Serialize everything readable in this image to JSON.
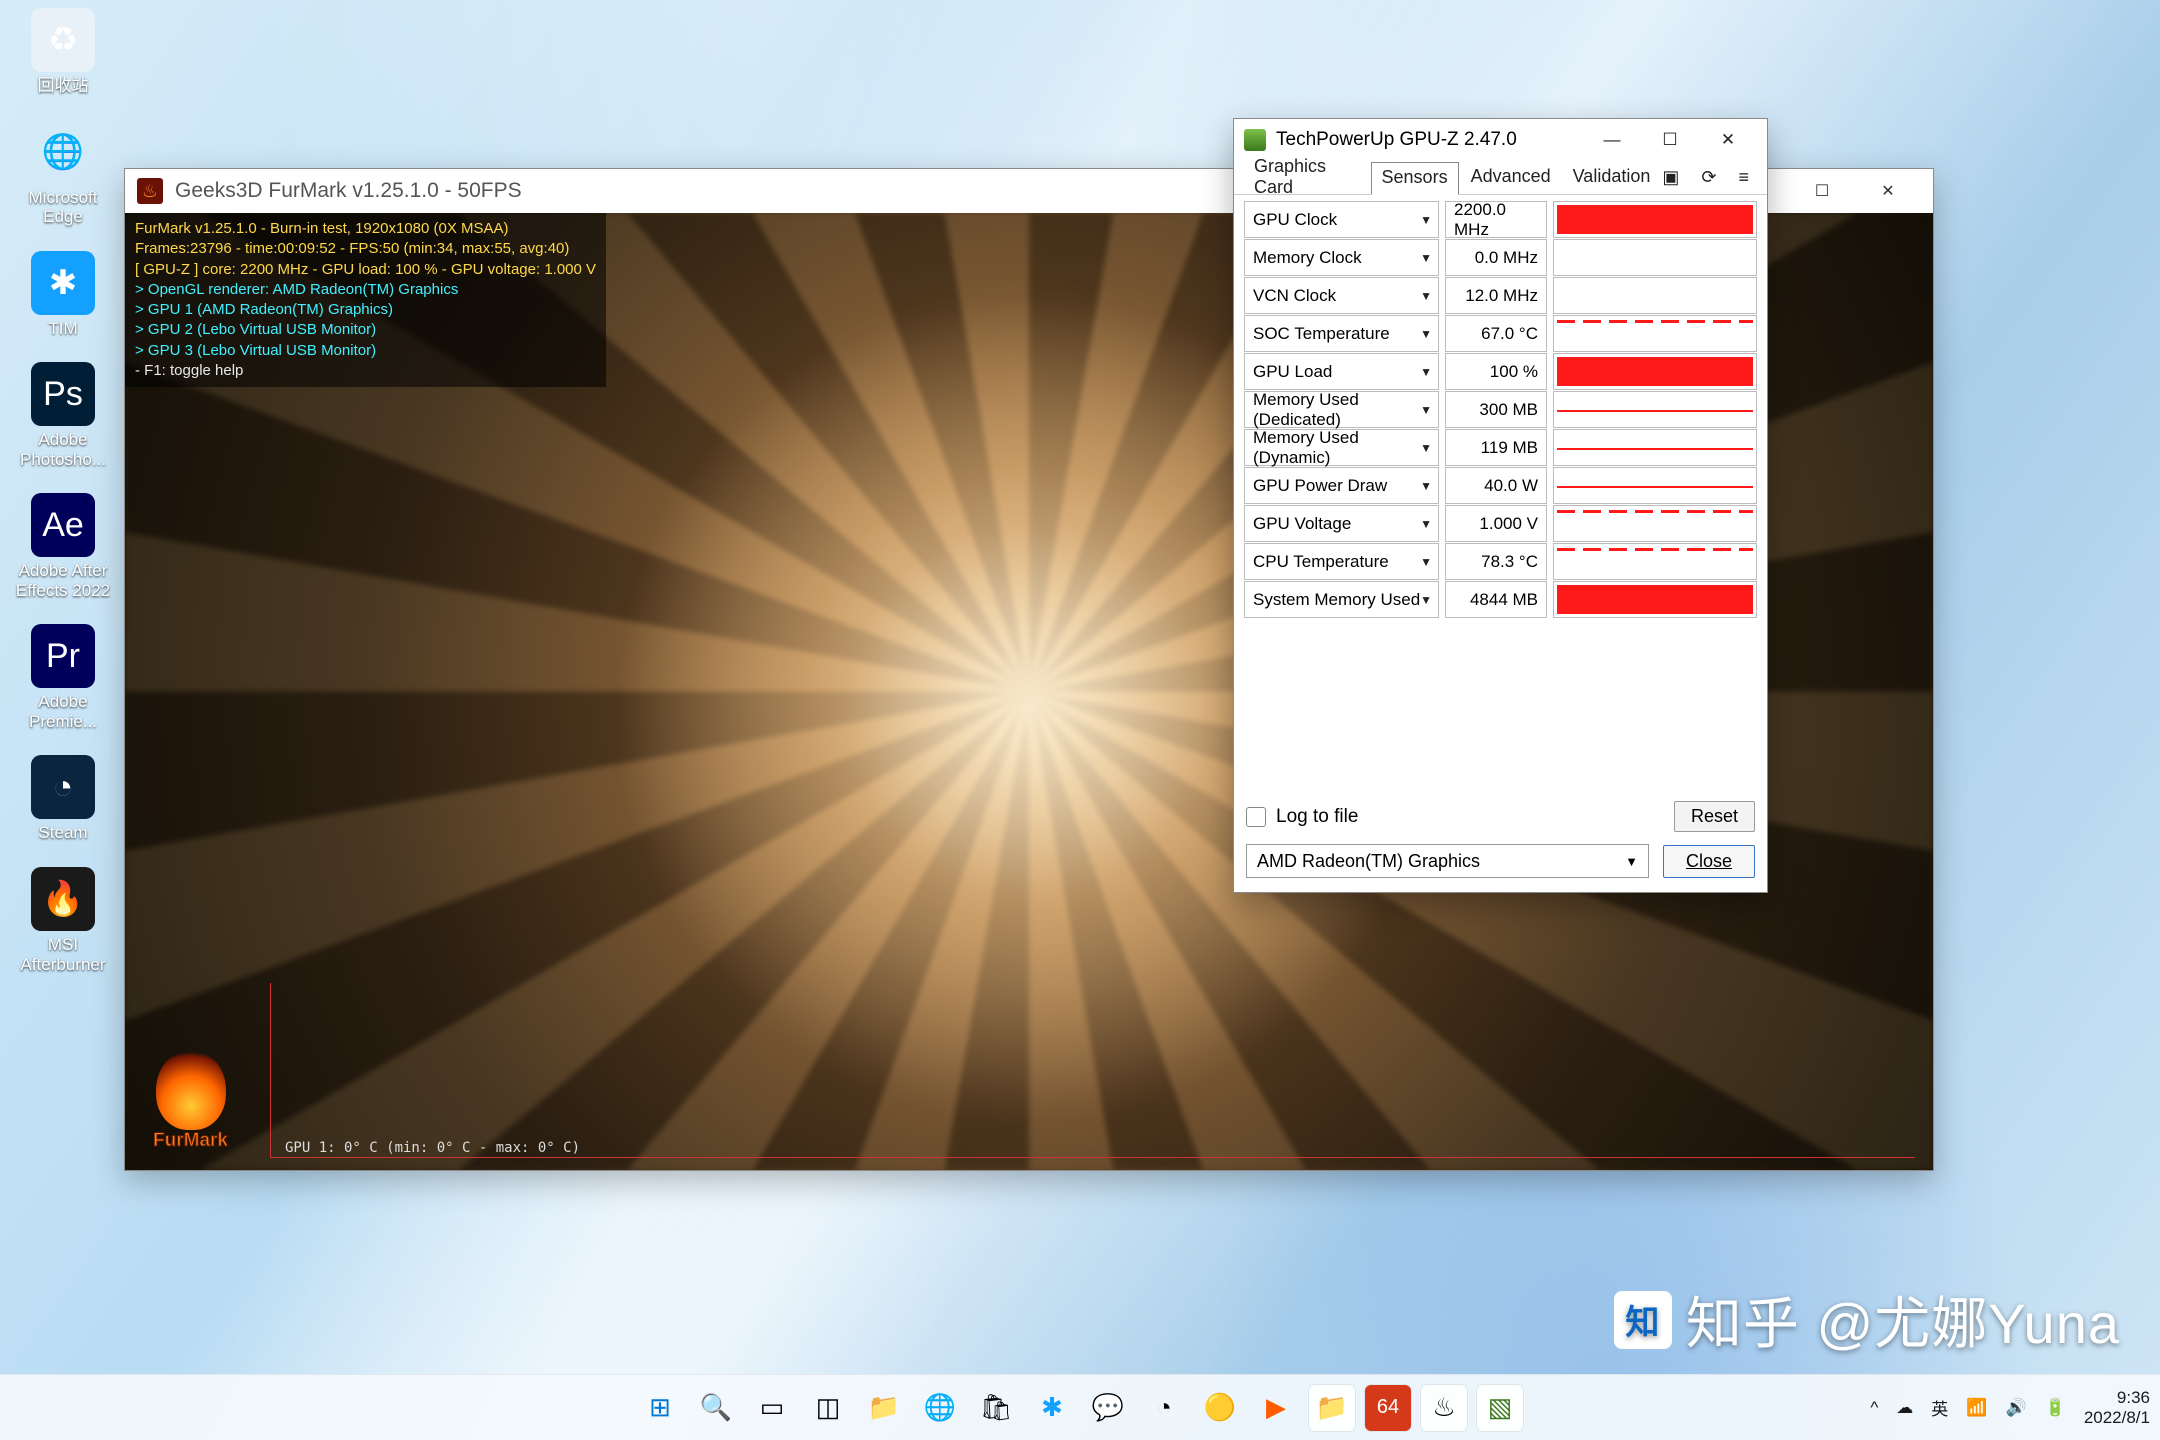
{
  "desktop_icons": [
    {
      "label": "回收站",
      "bg": "#e8f0f8",
      "glyph": "♻"
    },
    {
      "label": "Microsoft Edge",
      "bg": "transparent",
      "glyph": "🌐"
    },
    {
      "label": "TIM",
      "bg": "#14a0ff",
      "glyph": "✱"
    },
    {
      "label": "Adobe Photosho...",
      "bg": "#001e36",
      "glyph": "Ps"
    },
    {
      "label": "Adobe After Effects 2022",
      "bg": "#00005b",
      "glyph": "Ae"
    },
    {
      "label": "Adobe Premie...",
      "bg": "#00005b",
      "glyph": "Pr"
    },
    {
      "label": "Steam",
      "bg": "#0a2540",
      "glyph": "◔"
    },
    {
      "label": "MSI Afterburner",
      "bg": "#1a1a1a",
      "glyph": "🔥"
    }
  ],
  "furmark": {
    "title": "Geeks3D FurMark v1.25.1.0 - 50FPS",
    "overlay": {
      "l1": "FurMark v1.25.1.0 - Burn-in test, 1920x1080 (0X MSAA)",
      "l2": "Frames:23796 - time:00:09:52 - FPS:50 (min:34, max:55, avg:40)",
      "l3": "[ GPU-Z ] core: 2200 MHz - GPU load: 100 % - GPU voltage: 1.000 V",
      "l4": "> OpenGL renderer: AMD Radeon(TM) Graphics",
      "l5": "> GPU 1 (AMD Radeon(TM) Graphics)",
      "l6": "> GPU 2 (Lebo Virtual USB Monitor)",
      "l7": "> GPU 3 (Lebo Virtual USB Monitor)",
      "l8": "- F1: toggle help"
    },
    "graph_label": "GPU 1: 0° C (min: 0° C - max: 0° C)",
    "logo_text": "FurMark"
  },
  "gpuz": {
    "title": "TechPowerUp GPU-Z 2.47.0",
    "tabs": {
      "t1": "Graphics Card",
      "t2": "Sensors",
      "t3": "Advanced",
      "t4": "Validation"
    },
    "sensors": [
      {
        "label": "GPU Clock",
        "value": "2200.0 MHz",
        "style": "full"
      },
      {
        "label": "Memory Clock",
        "value": "0.0 MHz",
        "style": "none"
      },
      {
        "label": "VCN Clock",
        "value": "12.0 MHz",
        "style": "none"
      },
      {
        "label": "SOC Temperature",
        "value": "67.0 °C",
        "style": "dash"
      },
      {
        "label": "GPU Load",
        "value": "100 %",
        "style": "full"
      },
      {
        "label": "Memory Used (Dedicated)",
        "value": "300 MB",
        "style": "line"
      },
      {
        "label": "Memory Used (Dynamic)",
        "value": "119 MB",
        "style": "line"
      },
      {
        "label": "GPU Power Draw",
        "value": "40.0 W",
        "style": "line"
      },
      {
        "label": "GPU Voltage",
        "value": "1.000 V",
        "style": "dash"
      },
      {
        "label": "CPU Temperature",
        "value": "78.3 °C",
        "style": "dash"
      },
      {
        "label": "System Memory Used",
        "value": "4844 MB",
        "style": "full"
      }
    ],
    "log_label": "Log to file",
    "reset": "Reset",
    "gpu_selected": "AMD Radeon(TM) Graphics",
    "close": "Close"
  },
  "tray": {
    "chevron": "^",
    "ime": "英",
    "cloud": "☁",
    "wifi": "📶",
    "vol": "🔊",
    "batt": "🔋",
    "time": "9:36",
    "date": "2022/8/1"
  },
  "watermark": "知乎 @尤娜Yuna"
}
